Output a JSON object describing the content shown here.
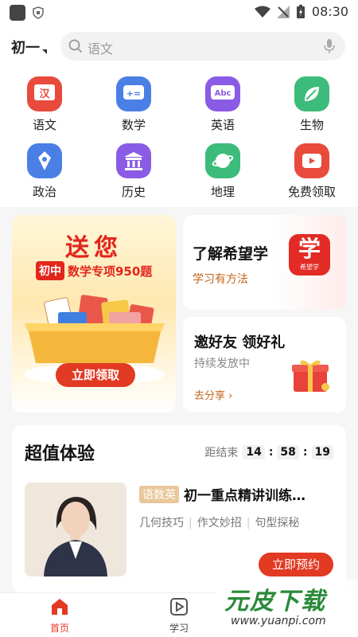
{
  "status_bar": {
    "time": "08:30"
  },
  "header": {
    "grade": "初一",
    "search_placeholder": "语文"
  },
  "subjects": [
    {
      "label": "语文",
      "icon": "chinese-icon",
      "color": "#e84a3c",
      "glyph": "汉"
    },
    {
      "label": "数学",
      "icon": "math-icon",
      "color": "#4a7fe6",
      "glyph": "+="
    },
    {
      "label": "英语",
      "icon": "english-icon",
      "color": "#8a5be4",
      "glyph": "Abc"
    },
    {
      "label": "生物",
      "icon": "biology-icon",
      "color": "#3dbb7a",
      "glyph": ""
    },
    {
      "label": "政治",
      "icon": "politics-icon",
      "color": "#4a7fe6",
      "glyph": ""
    },
    {
      "label": "历史",
      "icon": "history-icon",
      "color": "#8a5be4",
      "glyph": ""
    },
    {
      "label": "地理",
      "icon": "geography-icon",
      "color": "#3dbb7a",
      "glyph": ""
    },
    {
      "label": "免费领取",
      "icon": "free-claim-icon",
      "color": "#e84a3c",
      "glyph": ""
    }
  ],
  "promo": {
    "title": "送您",
    "tag": "初中",
    "text": "数学专项950题",
    "button": "立即领取"
  },
  "about_card": {
    "title": "了解希望学",
    "subtitle": "学习有方法",
    "logo_big": "学",
    "logo_small": "希望学"
  },
  "invite_card": {
    "title": "邀好友 领好礼",
    "subtitle": "持续发放中",
    "link": "去分享 ›"
  },
  "deal": {
    "title": "超值体验",
    "countdown_label": "距结束",
    "hours": "14",
    "minutes": "58",
    "seconds": "19",
    "course_badge": "语数英",
    "course_title": "初一重点精讲训练…",
    "tags": [
      "几何技巧",
      "作文妙招",
      "句型探秘"
    ],
    "button": "立即预约"
  },
  "tabs": [
    {
      "label": "首页",
      "icon": "home-icon",
      "active": true
    },
    {
      "label": "学习",
      "icon": "study-icon",
      "active": false
    }
  ],
  "watermark": {
    "text": "元皮下载",
    "url": "www.yuanpi.com"
  },
  "colors": {
    "accent": "#e23a23",
    "orange_text": "#c4651a"
  }
}
